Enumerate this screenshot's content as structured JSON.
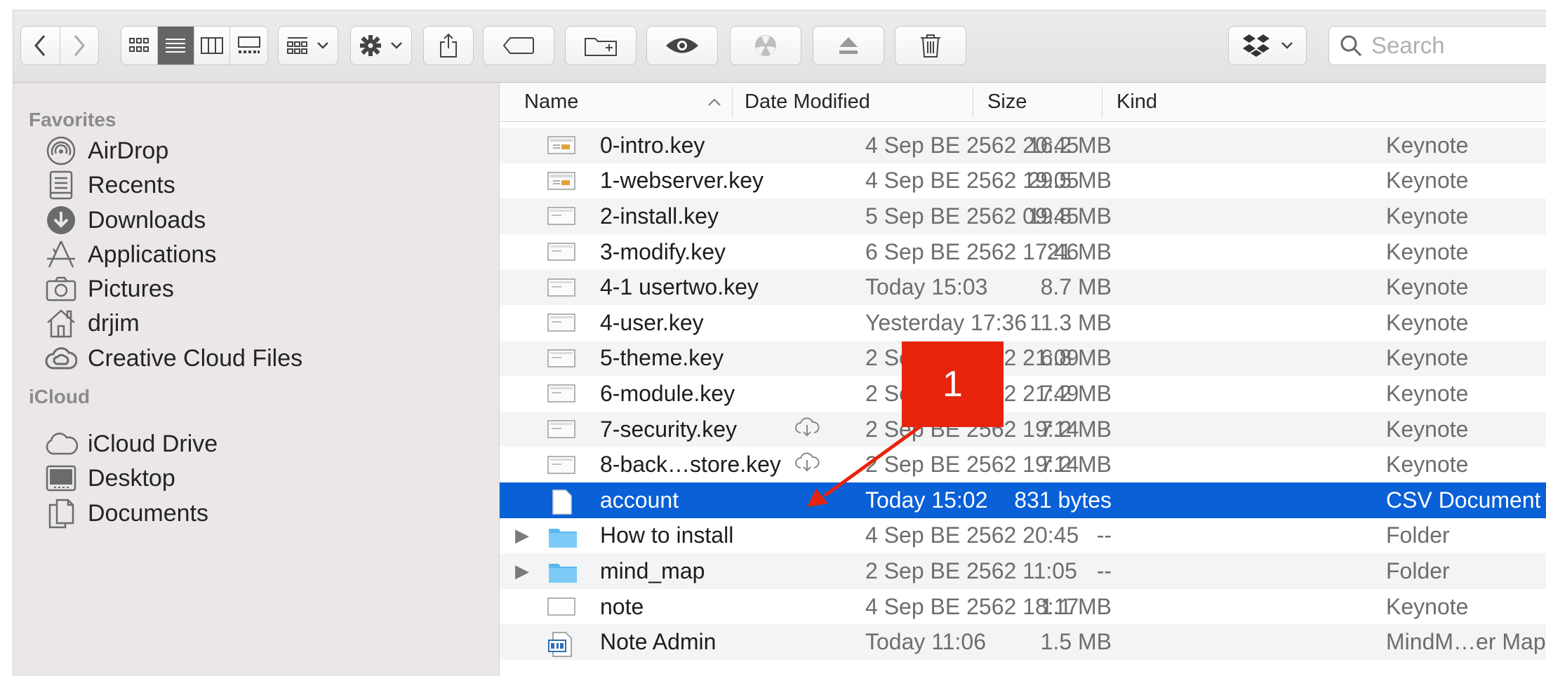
{
  "toolbar": {
    "search_placeholder": "Search"
  },
  "sidebar": {
    "favorites_label": "Favorites",
    "favorites": [
      {
        "label": "AirDrop",
        "icon": "airdrop-icon"
      },
      {
        "label": "Recents",
        "icon": "recents-icon"
      },
      {
        "label": "Downloads",
        "icon": "downloads-icon"
      },
      {
        "label": "Applications",
        "icon": "applications-icon"
      },
      {
        "label": "Pictures",
        "icon": "pictures-icon"
      },
      {
        "label": "drjim",
        "icon": "home-icon"
      },
      {
        "label": "Creative Cloud Files",
        "icon": "creative-cloud-icon"
      }
    ],
    "icloud_label": "iCloud",
    "icloud": [
      {
        "label": "iCloud Drive",
        "icon": "cloud-icon"
      },
      {
        "label": "Desktop",
        "icon": "desktop-icon"
      },
      {
        "label": "Documents",
        "icon": "documents-icon"
      }
    ]
  },
  "columns": {
    "name": "Name",
    "date": "Date Modified",
    "size": "Size",
    "kind": "Kind"
  },
  "files": [
    {
      "name": "0-intro.key",
      "date": "4 Sep BE 2562 20:45",
      "size": "16.2 MB",
      "kind": "Keynote"
    },
    {
      "name": "1-webserver.key",
      "date": "4 Sep BE 2562 19:05",
      "size": "29.5 MB",
      "kind": "Keynote"
    },
    {
      "name": "2-install.key",
      "date": "5 Sep BE 2562 09:45",
      "size": "19.8 MB",
      "kind": "Keynote"
    },
    {
      "name": "3-modify.key",
      "date": "6 Sep BE 2562 17:46",
      "size": "21 MB",
      "kind": "Keynote"
    },
    {
      "name": "4-1 usertwo.key",
      "date": "Today 15:03",
      "size": "8.7 MB",
      "kind": "Keynote"
    },
    {
      "name": "4-user.key",
      "date": "Yesterday 17:36",
      "size": "11.3 MB",
      "kind": "Keynote"
    },
    {
      "name": "5-theme.key",
      "date": "2 Sep BE 2562 21:09",
      "size": "6.8 MB",
      "kind": "Keynote"
    },
    {
      "name": "6-module.key",
      "date": "2 Sep BE 2562 21:49",
      "size": "7.2 MB",
      "kind": "Keynote"
    },
    {
      "name": "7-security.key",
      "date": "2 Sep BE 2562 19:14",
      "size": "7.2 MB",
      "kind": "Keynote"
    },
    {
      "name": "8-back…store.key",
      "date": "2 Sep BE 2562 19:14",
      "size": "7.2 MB",
      "kind": "Keynote"
    },
    {
      "name": "account",
      "date": "Today 15:02",
      "size": "831 bytes",
      "kind": "CSV Document"
    },
    {
      "name": "How to install",
      "date": "4 Sep BE 2562 20:45",
      "size": "--",
      "kind": "Folder"
    },
    {
      "name": "mind_map",
      "date": "2 Sep BE 2562 11:05",
      "size": "--",
      "kind": "Folder"
    },
    {
      "name": "note",
      "date": "4 Sep BE 2562 18:17",
      "size": "1.1 MB",
      "kind": "Keynote"
    },
    {
      "name": "Note Admin",
      "date": "Today 11:06",
      "size": "1.5 MB",
      "kind": "MindM…er Map"
    }
  ],
  "annotation": {
    "label": "1",
    "color": "#e8230c"
  },
  "colors": {
    "selection": "#0a60d6",
    "folder": "#5ab8ef"
  }
}
